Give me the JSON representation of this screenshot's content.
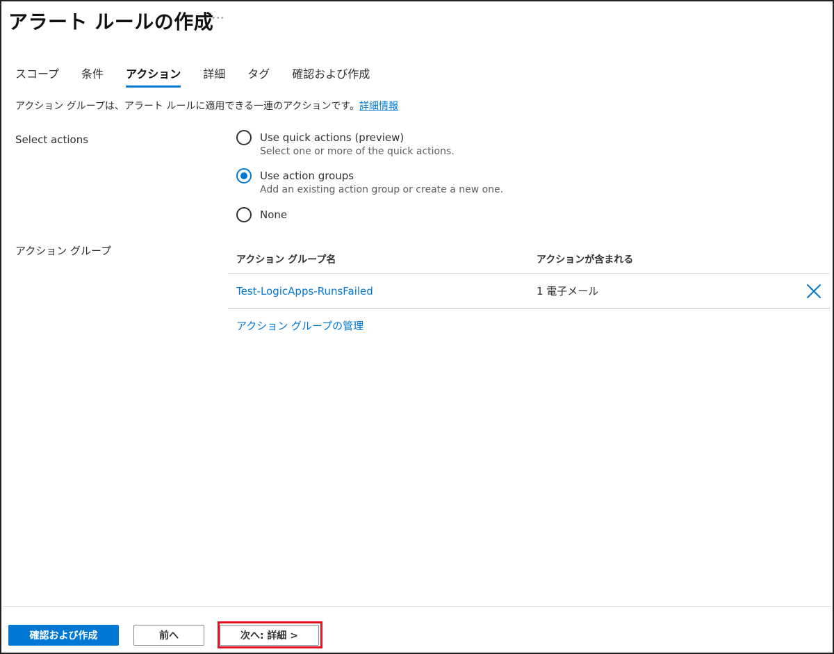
{
  "header": {
    "title": "アラート ルールの作成",
    "more_label": "···"
  },
  "tabs": [
    {
      "label": "スコープ",
      "active": false
    },
    {
      "label": "条件",
      "active": false
    },
    {
      "label": "アクション",
      "active": true
    },
    {
      "label": "詳細",
      "active": false
    },
    {
      "label": "タグ",
      "active": false
    },
    {
      "label": "確認および作成",
      "active": false
    }
  ],
  "description": {
    "text": "アクション グループは、アラート ルールに適用できる一連のアクションです。",
    "link": "詳細情報"
  },
  "select_actions": {
    "label": "Select actions",
    "options": [
      {
        "title": "Use quick actions (preview)",
        "subtitle": "Select one or more of the quick actions.",
        "selected": false
      },
      {
        "title": "Use action groups",
        "subtitle": "Add an existing action group or create a new one.",
        "selected": true
      },
      {
        "title": "None",
        "subtitle": "",
        "selected": false
      }
    ]
  },
  "action_groups": {
    "label": "アクション グループ",
    "columns": [
      "アクション グループ名",
      "アクションが含まれる"
    ],
    "rows": [
      {
        "name": "Test-LogicApps-RunsFailed",
        "actions": "1 電子メール"
      }
    ],
    "manage_link": "アクション グループの管理"
  },
  "footer": {
    "review_create": "確認および作成",
    "previous": "前へ",
    "next": "次へ: 詳細 >"
  },
  "colors": {
    "accent": "#0078d4",
    "highlight": "#e81123"
  },
  "icons": {
    "remove": "close-icon"
  }
}
